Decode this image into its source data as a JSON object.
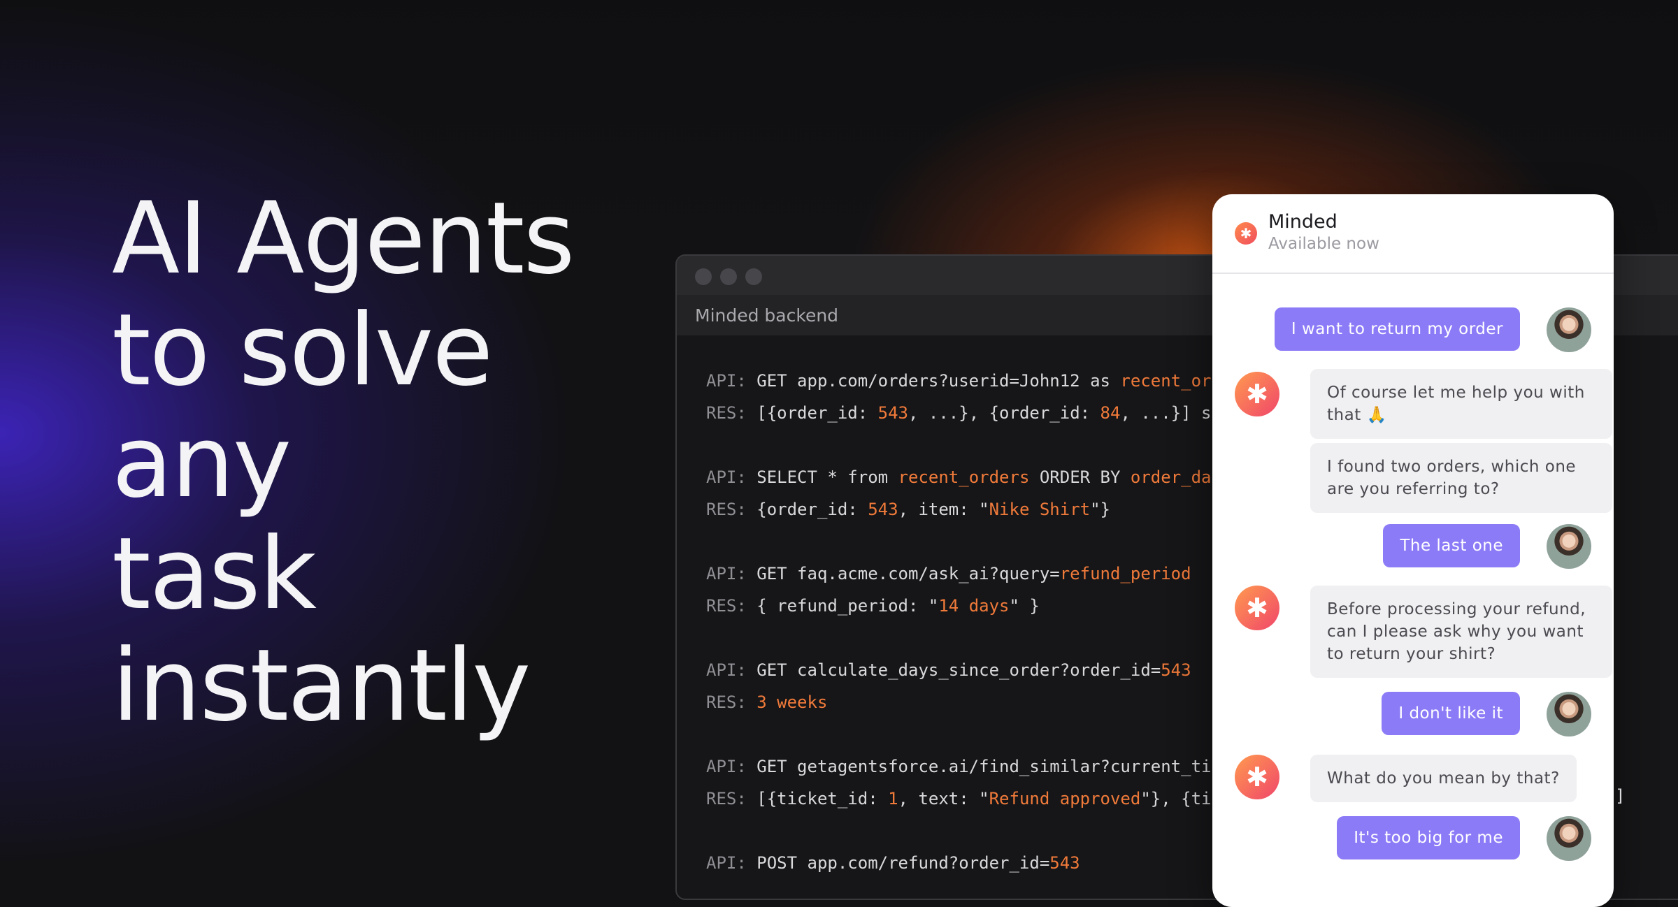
{
  "headline": [
    "AI Agents",
    "to solve",
    "any",
    "task",
    "instantly"
  ],
  "terminal": {
    "title": "Minded backend",
    "lines": [
      [
        [
          "kw",
          "API: "
        ],
        [
          "t",
          "GET app.com/orders?userid=John12 as "
        ],
        [
          "hl",
          "recent_orders"
        ]
      ],
      [
        [
          "kw",
          "RES: "
        ],
        [
          "t",
          "[{order_id: "
        ],
        [
          "hl",
          "543"
        ],
        [
          "t",
          ", ...}, {order_id: "
        ],
        [
          "hl",
          "84"
        ],
        [
          "t",
          ", ...}] sa"
        ]
      ],
      [
        [
          "kw",
          "API: "
        ],
        [
          "t",
          "SELECT * from "
        ],
        [
          "hl",
          "recent_orders"
        ],
        [
          "t",
          " ORDER BY "
        ],
        [
          "hl",
          "order_date"
        ]
      ],
      [
        [
          "kw",
          "RES: "
        ],
        [
          "t",
          "{order_id: "
        ],
        [
          "hl",
          "543"
        ],
        [
          "t",
          ", item: \""
        ],
        [
          "hl",
          "Nike Shirt"
        ],
        [
          "t",
          "\"}"
        ]
      ],
      [
        [
          "kw",
          "API: "
        ],
        [
          "t",
          "GET faq.acme.com/ask_ai?query="
        ],
        [
          "hl",
          "refund_period"
        ]
      ],
      [
        [
          "kw",
          "RES: "
        ],
        [
          "t",
          "{ refund_period: \""
        ],
        [
          "hl",
          "14 days"
        ],
        [
          "t",
          "\" }"
        ]
      ],
      [
        [
          "kw",
          "API: "
        ],
        [
          "t",
          "GET calculate_days_since_order?order_id="
        ],
        [
          "hl",
          "543"
        ]
      ],
      [
        [
          "kw",
          "RES: "
        ],
        [
          "hl",
          "3 weeks"
        ]
      ],
      [
        [
          "kw",
          "API: "
        ],
        [
          "t",
          "GET getagentsforce.ai/find_similar?current_ticket"
        ]
      ],
      [
        [
          "kw",
          "RES: "
        ],
        [
          "t",
          "[{ticket_id: "
        ],
        [
          "hl",
          "1"
        ],
        [
          "t",
          ", text: \""
        ],
        [
          "hl",
          "Refund approved"
        ],
        [
          "t",
          "\"}, {ticket"
        ]
      ],
      [
        [
          "kw",
          "API: "
        ],
        [
          "t",
          "POST app.com/refund?order_id="
        ],
        [
          "hl",
          "543"
        ]
      ]
    ],
    "trailing_bracket": "]"
  },
  "chat": {
    "name": "Minded",
    "status": "Available now",
    "brand_icon": "asterisk-logo-icon",
    "bot_glyph": "✱",
    "messages": [
      {
        "from": "user",
        "text": "I want to return my order"
      },
      {
        "from": "bot",
        "text": "Of course let me help you with that 🙏"
      },
      {
        "from": "bot",
        "text": "I found two orders, which one are you referring to?"
      },
      {
        "from": "user",
        "text": "The last one"
      },
      {
        "from": "bot",
        "text": "Before processing your refund, can I please ask why you want to return your shirt?"
      },
      {
        "from": "user",
        "text": "I don't like it"
      },
      {
        "from": "bot",
        "text": "What do you mean by that?"
      },
      {
        "from": "user",
        "text": "It's too big for me"
      }
    ]
  },
  "colors": {
    "accent_orange": "#f07a3a",
    "user_bubble": "#8c7bf7",
    "bot_bubble": "#f0f0f2",
    "background": "#121214"
  }
}
